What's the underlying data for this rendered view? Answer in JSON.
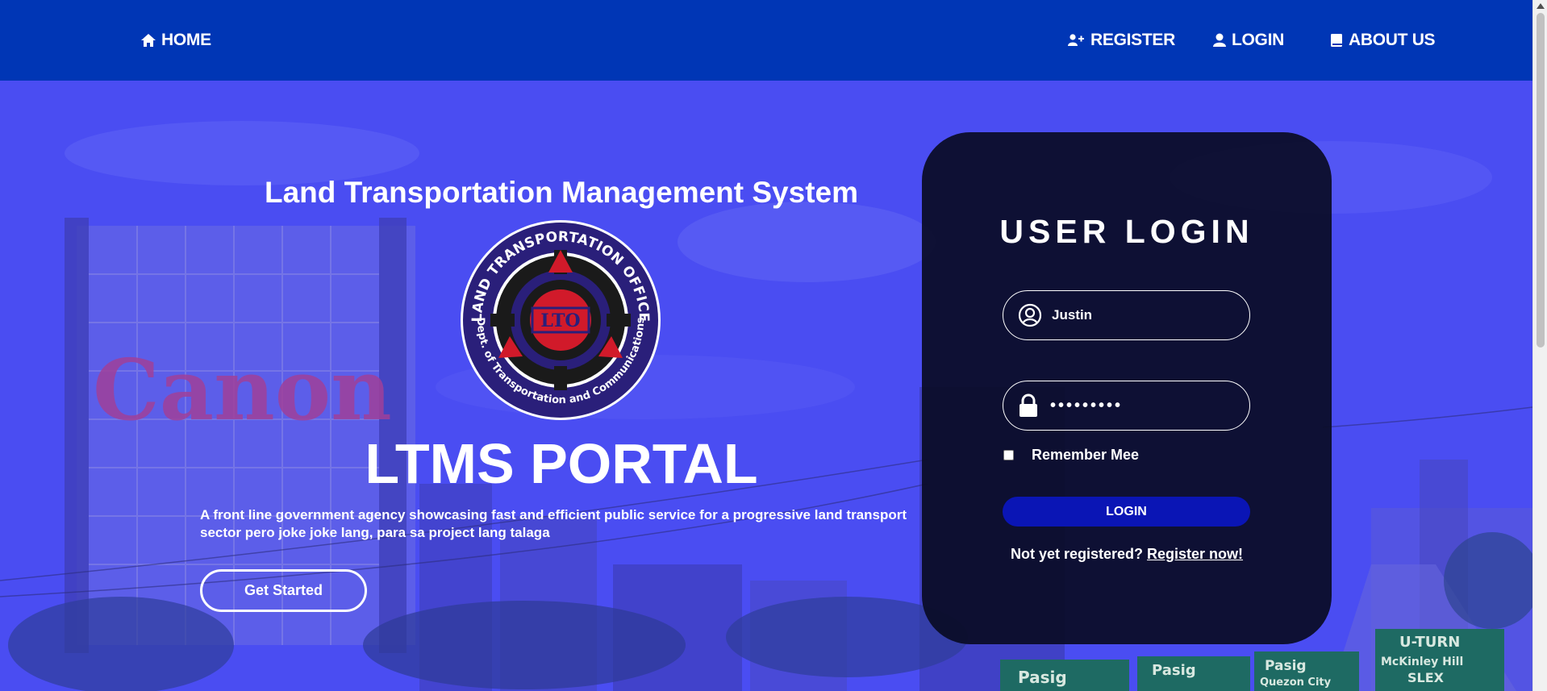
{
  "nav": {
    "home": "HOME",
    "register": "REGISTER",
    "login": "LOGIN",
    "about": "ABOUT US"
  },
  "hero": {
    "system_title": "Land Transportation Management System",
    "portal_title": "LTMS PORTAL",
    "description": "A front line government agency showcasing fast and efficient public service for a progressive land transport sector pero joke joke lang, para sa project lang talaga",
    "cta_label": "Get Started",
    "seal": {
      "outer_text": "LAND TRANSPORTATION OFFICE",
      "inner_text": "Dept. of Transportation and Communications",
      "center_text": "LTO"
    },
    "background_signs": [
      "Canon",
      "U-TURN",
      "McKinley Hill",
      "SLEX",
      "Pasig",
      "Quezon City"
    ]
  },
  "login_form": {
    "heading": "USER LOGIN",
    "username_value": "Justin",
    "password_mask": "•••••••••",
    "remember_label": "Remember Mee",
    "remember_checked": false,
    "submit_label": "LOGIN",
    "register_prompt": "Not yet registered?",
    "register_link": "Register now!"
  },
  "colors": {
    "navbar": "#0036b5",
    "hero_overlay": "#4a4df2",
    "card": "#0a0c26",
    "login_button": "#0a15b5",
    "seal_red": "#d11a2a"
  },
  "icons": {
    "home": "home-icon",
    "register": "user-plus-icon",
    "login": "user-icon",
    "about": "book-icon",
    "username": "user-circle-icon",
    "password": "lock-icon"
  }
}
